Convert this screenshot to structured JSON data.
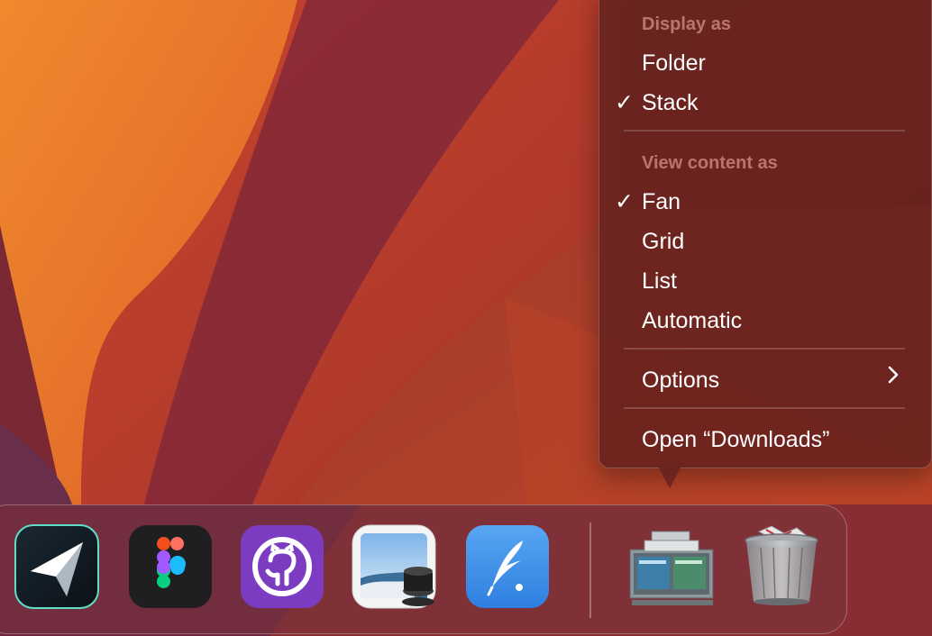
{
  "context_menu": {
    "display_as_header": "Display as",
    "folder": "Folder",
    "stack": "Stack",
    "view_content_header": "View content as",
    "fan": "Fan",
    "grid": "Grid",
    "list": "List",
    "automatic": "Automatic",
    "options": "Options",
    "open_downloads": "Open “Downloads”",
    "checkmark": "✓",
    "selected_display": "Stack",
    "selected_view": "Fan"
  },
  "dock": {
    "apps": [
      {
        "name": "Copilot",
        "icon": "paper-plane-icon"
      },
      {
        "name": "Figma",
        "icon": "figma-icon"
      },
      {
        "name": "GitHub Desktop",
        "icon": "github-icon"
      },
      {
        "name": "Preview",
        "icon": "preview-icon"
      },
      {
        "name": "Quill",
        "icon": "quill-icon"
      }
    ],
    "stacks": [
      {
        "name": "Downloads",
        "icon": "downloads-stack-icon"
      },
      {
        "name": "Trash",
        "icon": "trash-icon"
      }
    ]
  },
  "colors": {
    "menu_bg": "#69241e",
    "wallpaper_orange": "#e8812f",
    "wallpaper_maroon": "#6a2438"
  }
}
